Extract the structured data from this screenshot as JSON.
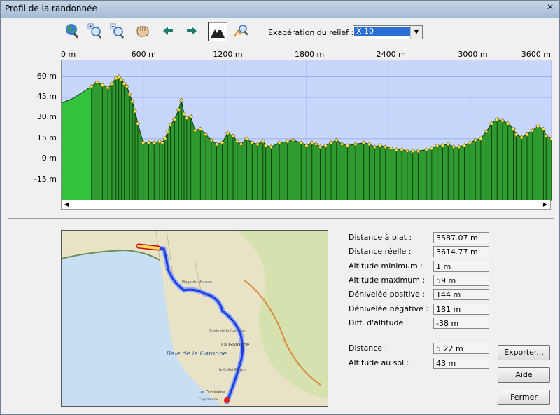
{
  "window": {
    "title": "Profil de la randonnée"
  },
  "toolbar": {
    "buttons": [
      "globe-zoom-icon",
      "zoom-in-icon",
      "zoom-out-icon",
      "pan-hand-icon",
      "arrow-left-icon",
      "arrow-right-icon",
      "terrain-icon",
      "route-zoom-icon"
    ],
    "exaggeration_label": "Exagération du relief :",
    "exaggeration_value": "X 10"
  },
  "chart_data": {
    "type": "area",
    "title": "",
    "xlabel": "",
    "ylabel": "",
    "x_ticks": [
      "0 m",
      "600 m",
      "1200 m",
      "1800 m",
      "2400 m",
      "3000 m",
      "3600 m"
    ],
    "y_ticks": [
      "60 m",
      "45 m",
      "30 m",
      "15 m",
      "0 m",
      "-15 m"
    ],
    "xlim": [
      0,
      3600
    ],
    "ylim": [
      -30,
      72
    ],
    "grid": true,
    "colors": {
      "fill": "#2f9a2f",
      "fill_light": "#33c23d",
      "background": "#c7d6fb",
      "marker": "#f5e35a"
    },
    "x": [
      0,
      80,
      160,
      220,
      260,
      300,
      340,
      370,
      400,
      420,
      440,
      460,
      480,
      500,
      520,
      540,
      560,
      600,
      640,
      680,
      720,
      740,
      760,
      780,
      800,
      830,
      860,
      880,
      900,
      920,
      950,
      980,
      1020,
      1060,
      1100,
      1140,
      1180,
      1220,
      1260,
      1290,
      1320,
      1360,
      1400,
      1440,
      1480,
      1500,
      1540,
      1600,
      1660,
      1700,
      1760,
      1800,
      1840,
      1870,
      1900,
      1940,
      1980,
      2020,
      2060,
      2100,
      2160,
      2220,
      2260,
      2300,
      2340,
      2380,
      2420,
      2460,
      2500,
      2540,
      2580,
      2620,
      2680,
      2720,
      2760,
      2800,
      2840,
      2880,
      2920,
      2960,
      3000,
      3040,
      3080,
      3120,
      3160,
      3200,
      3240,
      3280,
      3320,
      3340,
      3380,
      3420,
      3460,
      3500,
      3540,
      3560,
      3600
    ],
    "y": [
      41,
      44,
      49,
      53,
      56,
      54,
      52,
      55,
      59,
      60,
      58,
      55,
      53,
      47,
      42,
      35,
      26,
      12,
      12,
      12,
      13,
      12,
      15,
      20,
      25,
      29,
      36,
      43,
      33,
      30,
      31,
      21,
      22,
      18,
      14,
      11,
      12,
      19,
      17,
      13,
      11,
      15,
      12,
      11,
      13,
      10,
      9,
      12,
      13,
      14,
      12,
      10,
      12,
      11,
      9,
      10,
      12,
      14,
      11,
      10,
      11,
      12,
      11,
      9,
      10,
      9,
      8,
      7,
      7,
      6,
      6,
      6,
      7,
      8,
      10,
      10,
      11,
      9,
      9,
      10,
      12,
      14,
      15,
      20,
      26,
      29,
      28,
      26,
      22,
      18,
      16,
      18,
      21,
      24,
      22,
      17,
      15
    ]
  },
  "map": {
    "labels": [
      "Baie de la Garonne",
      "La Garonne",
      "Plage du Monaco",
      "Les Oursinières",
      "Pointe de la Garonne",
      "le Collet Redon",
      "Capitainerie"
    ],
    "colors": {
      "sea": "#c8def2",
      "land": "#e8e3c7",
      "route": "#1f3fd8",
      "route_glow": "#8fa8ff",
      "start": "#ffd95a",
      "end": "#e01f1f"
    }
  },
  "stats": [
    {
      "label": "Distance à plat :",
      "value": "3587.07 m"
    },
    {
      "label": "Distance réelle :",
      "value": "3614.77 m"
    },
    {
      "label": "Altitude minimum :",
      "value": "1 m"
    },
    {
      "label": "Altitude maximum :",
      "value": "59 m"
    },
    {
      "label": "Dénivelée positive :",
      "value": "144 m"
    },
    {
      "label": "Dénivelée négative :",
      "value": "181 m"
    },
    {
      "label": "Diff. d'altitude :",
      "value": "-38 m"
    }
  ],
  "cursor": [
    {
      "label": "Distance :",
      "value": "5.22 m"
    },
    {
      "label": "Altitude au sol :",
      "value": "43 m"
    }
  ],
  "buttons": {
    "export": "Exporter...",
    "help": "Aide",
    "close": "Fermer"
  }
}
